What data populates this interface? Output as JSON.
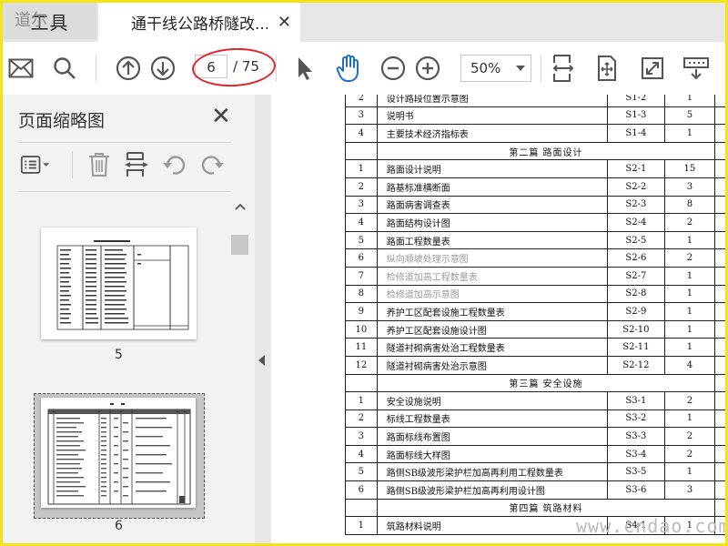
{
  "tabs": {
    "tools_label": "工具",
    "doc_title": "通干线公路桥隧改...",
    "close_glyph": "✕"
  },
  "watermarks": {
    "top_left": "道尔",
    "bottom_right": "www.cndao.com"
  },
  "toolbar": {
    "page_current": "6",
    "page_total": "/ 75",
    "zoom": "50%"
  },
  "sidebar": {
    "title": "页面缩略图",
    "close_glyph": "✕",
    "thumbnails": [
      {
        "label": "5"
      },
      {
        "label": "6"
      }
    ]
  },
  "document": {
    "rows": [
      {
        "type": "item",
        "no": "2",
        "name": "设计路段位置示意图",
        "code": "S1-2",
        "qty": "1"
      },
      {
        "type": "item",
        "no": "3",
        "name": "说明书",
        "code": "S1-3",
        "qty": "5"
      },
      {
        "type": "item",
        "no": "4",
        "name": "主要技术经济指标表",
        "code": "S1-4",
        "qty": "1"
      },
      {
        "type": "section",
        "name": "第二篇  路面设计"
      },
      {
        "type": "item",
        "no": "1",
        "name": "路面设计说明",
        "code": "S2-1",
        "qty": "15"
      },
      {
        "type": "item",
        "no": "2",
        "name": "路基标准横断面",
        "code": "S2-2",
        "qty": "3"
      },
      {
        "type": "item",
        "no": "3",
        "name": "路面病害调查表",
        "code": "S2-3",
        "qty": "8"
      },
      {
        "type": "item",
        "no": "4",
        "name": "路面结构设计图",
        "code": "S2-4",
        "qty": "2"
      },
      {
        "type": "item",
        "no": "5",
        "name": "路面工程数量表",
        "code": "S2-5",
        "qty": "1"
      },
      {
        "type": "item",
        "no": "6",
        "name": "纵向顺坡处理示意图",
        "code": "S2-6",
        "qty": "2",
        "faded": true
      },
      {
        "type": "item",
        "no": "7",
        "name": "检修道加高工程数量表",
        "code": "S2-7",
        "qty": "1",
        "faded": true
      },
      {
        "type": "item",
        "no": "8",
        "name": "检修道加高示意图",
        "code": "S2-8",
        "qty": "1",
        "faded": true
      },
      {
        "type": "item",
        "no": "9",
        "name": "养护工区配套设施工程数量表",
        "code": "S2-9",
        "qty": "1"
      },
      {
        "type": "item",
        "no": "10",
        "name": "养护工区配套设施设计图",
        "code": "S2-10",
        "qty": "1"
      },
      {
        "type": "item",
        "no": "11",
        "name": "隧道衬砌病害处治工程数量表",
        "code": "S2-11",
        "qty": "1"
      },
      {
        "type": "item",
        "no": "12",
        "name": "隧道衬砌病害处治示意图",
        "code": "S2-12",
        "qty": "4"
      },
      {
        "type": "section",
        "name": "第三篇  安全设施"
      },
      {
        "type": "item",
        "no": "1",
        "name": "安全设施说明",
        "code": "S3-1",
        "qty": "2"
      },
      {
        "type": "item",
        "no": "2",
        "name": "标线工程数量表",
        "code": "S3-2",
        "qty": "1"
      },
      {
        "type": "item",
        "no": "3",
        "name": "路面标线布置图",
        "code": "S3-3",
        "qty": "2"
      },
      {
        "type": "item",
        "no": "4",
        "name": "路面标线大样图",
        "code": "S3-4",
        "qty": "2"
      },
      {
        "type": "item",
        "no": "5",
        "name": "路侧SB级波形梁护栏加高再利用工程数量表",
        "code": "S3-5",
        "qty": "1"
      },
      {
        "type": "item",
        "no": "6",
        "name": "路侧SB级波形梁护栏加高再利用设计图",
        "code": "S3-6",
        "qty": "3"
      },
      {
        "type": "section",
        "name": "第四篇  筑路材料"
      },
      {
        "type": "item",
        "no": "1",
        "name": "筑路材料说明",
        "code": "S4-1",
        "qty": "1"
      }
    ]
  }
}
